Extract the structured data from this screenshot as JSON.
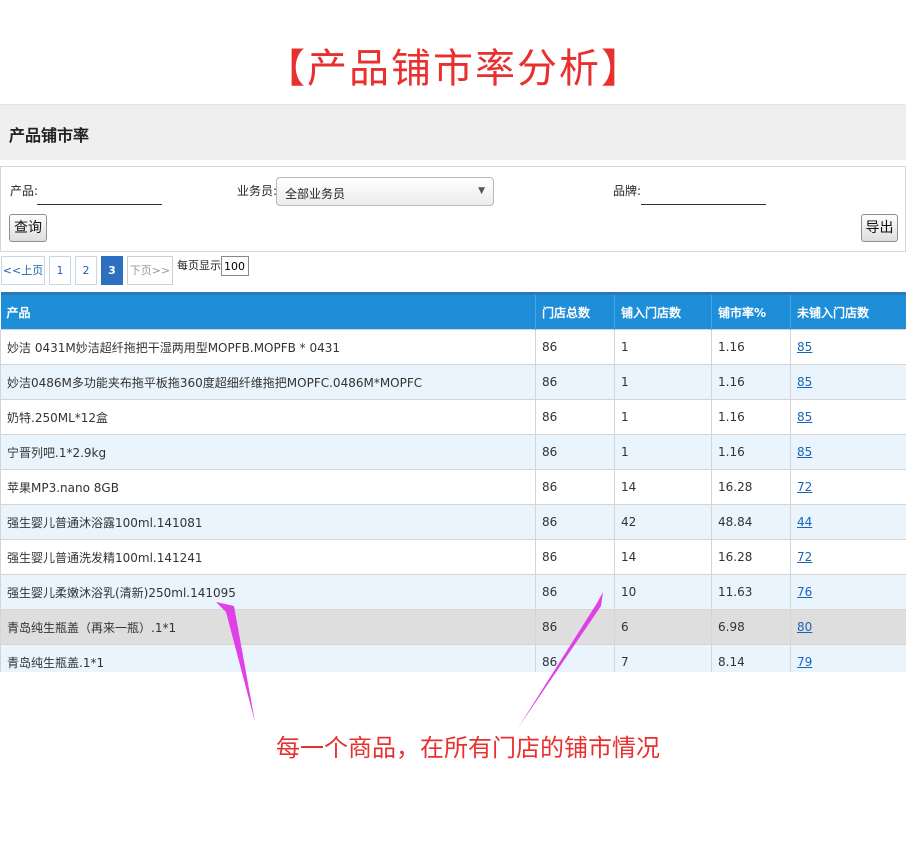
{
  "title": "【产品铺市率分析】",
  "panel": {
    "title": "产品铺市率"
  },
  "filters": {
    "product_label": "产品:",
    "product_value": "",
    "salesman_label": "业务员:",
    "salesman_value": "全部业务员",
    "brand_label": "品牌:",
    "brand_value": "",
    "query_button": "查询",
    "export_button": "导出"
  },
  "pager": {
    "prev": "<<上页",
    "pages": [
      "1",
      "2",
      "3"
    ],
    "current_page": "3",
    "next": "下页>>",
    "per_page_label": "每页显示",
    "per_page_value": "100"
  },
  "table": {
    "columns": [
      "产品",
      "门店总数",
      "铺入门店数",
      "铺市率%",
      "未铺入门店数"
    ],
    "rows": [
      [
        "妙洁 0431M妙洁超纤拖把干湿两用型MOPFB.MOPFB * 0431",
        "86",
        "1",
        "1.16",
        "85"
      ],
      [
        "妙洁0486M多功能夹布拖平板拖360度超细纤维拖把MOPFC.0486M*MOPFC",
        "86",
        "1",
        "1.16",
        "85"
      ],
      [
        "奶特.250ML*12盒",
        "86",
        "1",
        "1.16",
        "85"
      ],
      [
        "宁晋列吧.1*2.9kg",
        "86",
        "1",
        "1.16",
        "85"
      ],
      [
        "苹果MP3.nano 8GB",
        "86",
        "14",
        "16.28",
        "72"
      ],
      [
        "强生婴儿普通沐浴露100ml.141081",
        "86",
        "42",
        "48.84",
        "44"
      ],
      [
        "强生婴儿普通洗发精100ml.141241",
        "86",
        "14",
        "16.28",
        "72"
      ],
      [
        "强生婴儿柔嫩沐浴乳(清新)250ml.141095",
        "86",
        "10",
        "11.63",
        "76"
      ],
      [
        "青岛纯生瓶盖（再来一瓶）.1*1",
        "86",
        "6",
        "6.98",
        "80"
      ],
      [
        "青岛纯生瓶盖.1*1",
        "86",
        "7",
        "8.14",
        "79"
      ]
    ]
  },
  "annotation": {
    "text": "每一个商品，在所有门店的铺市情况",
    "color": "#e040e8"
  },
  "colors": {
    "title_red": "#e8302f",
    "header_blue": "#1e8ed8",
    "row_alt": "#e9f4fc"
  }
}
